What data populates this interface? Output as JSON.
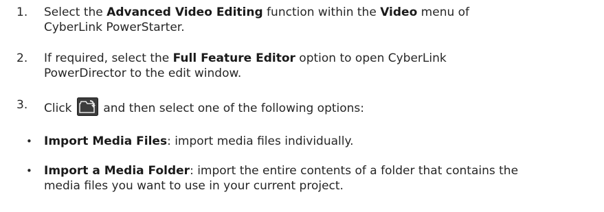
{
  "steps": [
    {
      "number": "1.",
      "t1": "Select the ",
      "b1": "Advanced Video Editing",
      "t2": " function within the ",
      "b2": "Video",
      "t3": " menu of",
      "line2": "CyberLink PowerStarter."
    },
    {
      "number": "2.",
      "t1": "If required, select the ",
      "b1": "Full Feature Editor",
      "t2": " option to open CyberLink",
      "line2": "PowerDirector to the edit window."
    },
    {
      "number": "3.",
      "t1": "Click ",
      "icon": "import-media-icon",
      "t2": " and then select one of the following options:"
    }
  ],
  "bullets": [
    {
      "marker": "•",
      "bold": "Import Media Files",
      "text": ": import media files individually."
    },
    {
      "marker": "•",
      "bold": "Import a Media Folder",
      "text": ": import the entire contents of a folder that contains the",
      "line2": "media files you want to use in your current project."
    }
  ],
  "colors": {
    "text": "#262626",
    "icon_bg": "#3c3c3c",
    "icon_fg": "#e6e6e6"
  }
}
